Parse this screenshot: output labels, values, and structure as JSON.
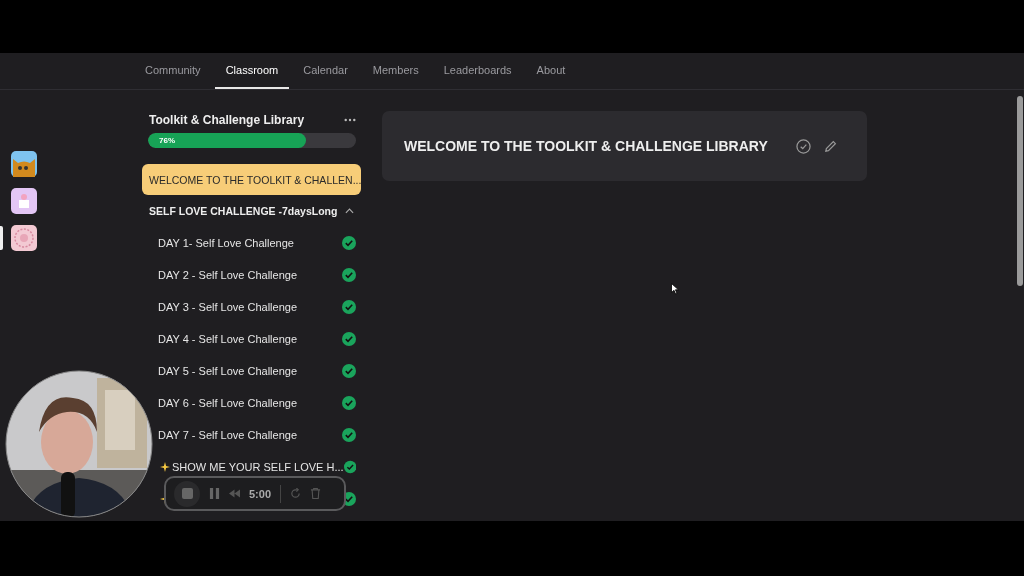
{
  "nav": {
    "tabs": [
      {
        "label": "Community",
        "selected": false
      },
      {
        "label": "Classroom",
        "selected": true
      },
      {
        "label": "Calendar",
        "selected": false
      },
      {
        "label": "Members",
        "selected": false
      },
      {
        "label": "Leaderboards",
        "selected": false
      },
      {
        "label": "About",
        "selected": false
      }
    ]
  },
  "groups": [
    {
      "kind": "cat",
      "selected": false
    },
    {
      "kind": "cake",
      "selected": false
    },
    {
      "kind": "seal",
      "selected": true
    }
  ],
  "course": {
    "title": "Toolkit & Challenge Library",
    "progress_label": "76%",
    "level": 0.76
  },
  "modules": [
    {
      "title": "WELCOME TO THE TOOLKIT & CHALLEN...",
      "selected": true
    }
  ],
  "section": {
    "title": "SELF LOVE CHALLENGE -7daysLong",
    "expanded": true
  },
  "lessons": [
    {
      "title": "DAY 1- Self Love Challenge",
      "sparkle": false,
      "done": true
    },
    {
      "title": "DAY 2 - Self Love Challenge",
      "sparkle": false,
      "done": true
    },
    {
      "title": "DAY 3 - Self Love Challenge",
      "sparkle": false,
      "done": true
    },
    {
      "title": "DAY 4 - Self Love Challenge",
      "sparkle": false,
      "done": true
    },
    {
      "title": "DAY 5 - Self Love Challenge",
      "sparkle": false,
      "done": true
    },
    {
      "title": "DAY 6 - Self Love Challenge",
      "sparkle": false,
      "done": true
    },
    {
      "title": "DAY 7 - Self Love Challenge",
      "sparkle": false,
      "done": true
    },
    {
      "title": "SHOW ME YOUR SELF LOVE H...",
      "sparkle": true,
      "done": true
    },
    {
      "sparkle": true,
      "done": true
    }
  ],
  "content": {
    "title": "WELCOME TO THE TOOLKIT & CHALLENGE LIBRARY",
    "completed": false
  },
  "recorder": {
    "time": "5:00"
  }
}
